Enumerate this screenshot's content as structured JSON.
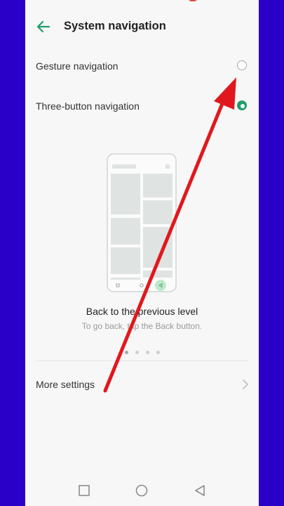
{
  "header": {
    "title": "System navigation"
  },
  "options": [
    {
      "label": "Gesture navigation",
      "selected": false
    },
    {
      "label": "Three-button navigation",
      "selected": true
    }
  ],
  "illustration": {
    "caption_title": "Back to the previous level",
    "caption_subtitle": "To go back, tap the Back button.",
    "page_dots": 4,
    "active_dot": 0
  },
  "more_settings": {
    "label": "More settings"
  },
  "colors": {
    "accent": "#1e9e6a",
    "side_bars": "#2a00c8",
    "annotation_arrow": "#e0181d"
  },
  "icons": {
    "back": "arrow-left-icon",
    "chevron": "chevron-right-icon",
    "nav_recents": "square-icon",
    "nav_home": "circle-icon",
    "nav_back": "triangle-left-icon"
  }
}
